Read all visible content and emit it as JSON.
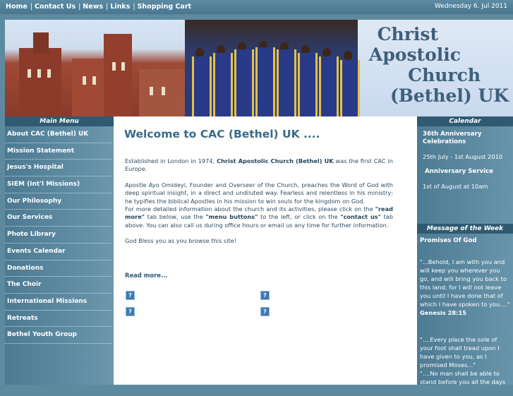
{
  "topnav": {
    "items": [
      "Home",
      "Contact Us",
      "News",
      "Links",
      "Shopping Cart"
    ],
    "date": "Wednesday 6. Jul 2011"
  },
  "banner": {
    "name_line1": "Christ",
    "name_line2": "Apostolic",
    "name_line3": "Church",
    "name_line4": "(Bethel) UK"
  },
  "leftmenu": {
    "heading": "Main Menu",
    "items": [
      "About CAC (Bethel) UK",
      "Mission Statement",
      "Jesus's Hospital",
      "SIEM (Int'l Missions)",
      "Our Philosophy",
      "Our Services",
      "Photo Library",
      "Events Calendar",
      "Donations",
      "The Choir",
      "International Missions",
      "Retreats",
      "Bethel Youth Group"
    ]
  },
  "main": {
    "title": "Welcome to CAC (Bethel) UK ....",
    "p1_pre": "Established in London in 1974, ",
    "p1_bold": "Christ Apostolic Church (Bethel) UK",
    "p1_post": " was the first CAC in Europe.",
    "p2": "Apostle Ayo Omideyi, Founder and Overseer of the Church, preaches the Word of God with deep spiritual insight, in a direct and undiluted way. Fearless and relentless in his ministry; he typifies the biblical Apostles in his mission to win souls for the kingdom on God.",
    "p3_a": "For more detailed information about the church and its activities, please click on the ",
    "p3_b": "\"read more\"",
    "p3_c": " tab below, use the ",
    "p3_d": "\"menu buttons\"",
    "p3_e": " to the left, or click on the ",
    "p3_f": "\"contact us\"",
    "p3_g": " tab above. You can also call us during office hours or email us any time for further information.",
    "p4": "God Bless you as you browse this site!",
    "read_more": "Read more...",
    "image_placeholder": "?"
  },
  "calendar": {
    "heading": "Calendar",
    "event1_title": "36th Anniversary Celebrations",
    "event1_date": "25th July - 1st August 2010",
    "event2_title": "Anniversary Service",
    "event2_date": "1st of August at 10am"
  },
  "message": {
    "heading": "Message of the Week",
    "title": "Promises Of God",
    "quote1": "\"...Behold, I am with you and will keep you wherever you go, and will bring you back to this land; for I will not leave you until I have done that of which I have spoken to you....\"",
    "quote1_ref": "Genesis 28:15",
    "quote2": "\"....Every place the sole of your foot shall tread upon I have given to you, as I promised Moses...\"",
    "quote3": "\"....No man shall be able to stand before you all the days"
  }
}
